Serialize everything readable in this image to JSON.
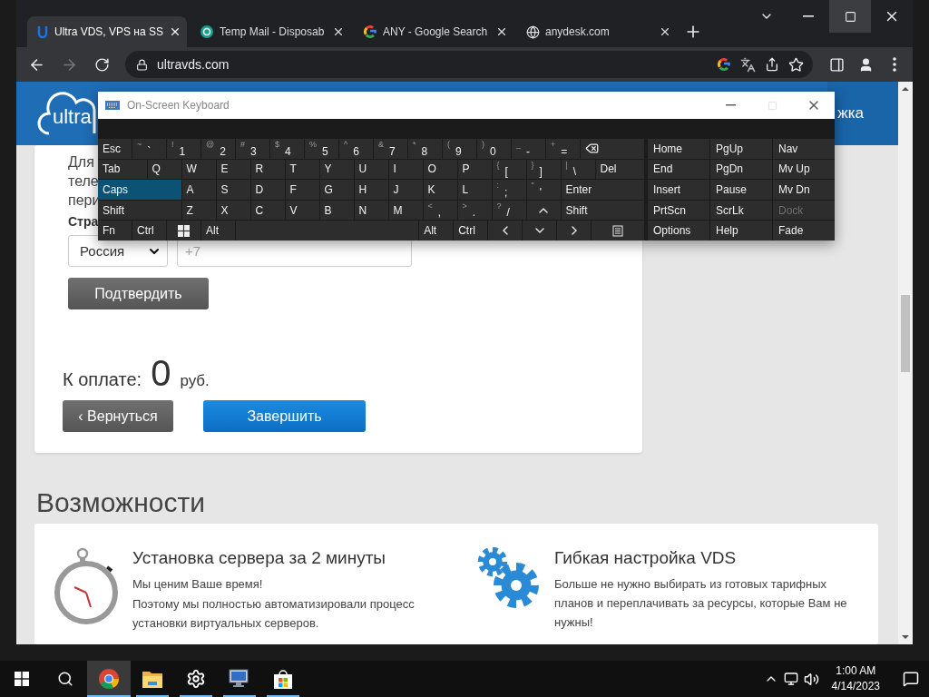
{
  "browser": {
    "tabs": [
      {
        "kind": "ultra",
        "title": "Ultra VDS, VPS на SS",
        "selected": true
      },
      {
        "kind": "mail",
        "title": "Temp Mail - Disposab",
        "selected": false
      },
      {
        "kind": "google",
        "title": "ANY - Google Search",
        "selected": false
      },
      {
        "kind": "globe",
        "title": "anydesk.com",
        "selected": false
      }
    ],
    "window_controls": [
      {
        "kind": "tabsearch",
        "hovered": false
      },
      {
        "kind": "minimize",
        "hovered": false
      },
      {
        "kind": "maximize",
        "hovered": true
      },
      {
        "kind": "close",
        "hovered": false
      }
    ],
    "nav": [
      {
        "kind": "back",
        "disabled": false
      },
      {
        "kind": "forward",
        "disabled": true
      },
      {
        "kind": "reload",
        "disabled": false
      }
    ],
    "address": "ultravds.com"
  },
  "page": {
    "header": {
      "logo": "ultra",
      "nav_item": "жка"
    },
    "order_card": {
      "lines": [
        "Для",
        "теле",
        "пери"
      ],
      "country_label": "Стра",
      "country": "Россия",
      "phone_placeholder": "+7",
      "confirm_button": "Подтвердить",
      "total_label": "К оплате:",
      "total": "0",
      "currency": "руб.",
      "back_button": "‹ Вернуться",
      "finish_button": "Завершить"
    },
    "features": {
      "heading": "Возможности",
      "items": [
        {
          "kind": "stopwatch",
          "title": "Установка сервера за 2 минуты",
          "paragraphs": [
            "Мы ценим Ваше время!",
            "Поэтому мы полностью автоматизировали процесс установки виртуальных серверов."
          ]
        },
        {
          "kind": "gears",
          "title": "Гибкая настройка VDS",
          "paragraphs": [
            "Больше не нужно выбирать из готовых тарифных планов и переплачивать за ресурсы, которые Вам не нужны!"
          ]
        }
      ]
    }
  },
  "keyboard": {
    "title": "On-Screen Keyboard",
    "maximize_disabled": true,
    "rows": [
      {
        "keys": [
          {
            "kind": "key",
            "label": "Esc",
            "on": false
          },
          {
            "kind": "char",
            "shift": "~",
            "label": "`",
            "on": false
          },
          {
            "kind": "char",
            "shift": "!",
            "label": "1",
            "on": false
          },
          {
            "kind": "char",
            "shift": "@",
            "label": "2",
            "on": false
          },
          {
            "kind": "char",
            "shift": "#",
            "label": "3",
            "on": false
          },
          {
            "kind": "char",
            "shift": "$",
            "label": "4",
            "on": false
          },
          {
            "kind": "char",
            "shift": "%",
            "label": "5",
            "on": false
          },
          {
            "kind": "char",
            "shift": "^",
            "label": "6",
            "on": false
          },
          {
            "kind": "char",
            "shift": "&",
            "label": "7",
            "on": false
          },
          {
            "kind": "char",
            "shift": "*",
            "label": "8",
            "on": false
          },
          {
            "kind": "char",
            "shift": "(",
            "label": "9",
            "on": false
          },
          {
            "kind": "char",
            "shift": ")",
            "label": "0",
            "on": false
          },
          {
            "kind": "char",
            "shift": "_",
            "label": "-",
            "on": false
          },
          {
            "kind": "char",
            "shift": "+",
            "label": "=",
            "on": false
          },
          {
            "kind": "backspace",
            "on": false
          }
        ]
      },
      {
        "keys": [
          {
            "kind": "wide",
            "label": "Tab",
            "on": false
          },
          {
            "kind": "key",
            "label": "Q",
            "on": false
          },
          {
            "kind": "key",
            "label": "W",
            "on": false
          },
          {
            "kind": "key",
            "label": "E",
            "on": false
          },
          {
            "kind": "key",
            "label": "R",
            "on": false
          },
          {
            "kind": "key",
            "label": "T",
            "on": false
          },
          {
            "kind": "key",
            "label": "Y",
            "on": false
          },
          {
            "kind": "key",
            "label": "U",
            "on": false
          },
          {
            "kind": "key",
            "label": "I",
            "on": false
          },
          {
            "kind": "key",
            "label": "O",
            "on": false
          },
          {
            "kind": "key",
            "label": "P",
            "on": false
          },
          {
            "kind": "char",
            "shift": "{",
            "label": "[",
            "on": false
          },
          {
            "kind": "char",
            "shift": "}",
            "label": "]",
            "on": false
          },
          {
            "kind": "char",
            "shift": "|",
            "label": "\\",
            "on": false
          },
          {
            "kind": "wide",
            "label": "Del",
            "on": false
          }
        ]
      },
      {
        "keys": [
          {
            "kind": "wide",
            "label": "Caps",
            "on": true
          },
          {
            "kind": "key",
            "label": "A",
            "on": false
          },
          {
            "kind": "key",
            "label": "S",
            "on": false
          },
          {
            "kind": "key",
            "label": "D",
            "on": false
          },
          {
            "kind": "key",
            "label": "F",
            "on": false
          },
          {
            "kind": "key",
            "label": "G",
            "on": false
          },
          {
            "kind": "key",
            "label": "H",
            "on": false
          },
          {
            "kind": "key",
            "label": "J",
            "on": false
          },
          {
            "kind": "key",
            "label": "K",
            "on": false
          },
          {
            "kind": "key",
            "label": "L",
            "on": false
          },
          {
            "kind": "char",
            "shift": ":",
            "label": ";",
            "on": false
          },
          {
            "kind": "char",
            "shift": "\"",
            "label": "'",
            "on": false
          },
          {
            "kind": "wide",
            "label": "Enter",
            "on": false
          }
        ]
      },
      {
        "keys": [
          {
            "kind": "wide",
            "label": "Shift",
            "on": false
          },
          {
            "kind": "key",
            "label": "Z",
            "on": false
          },
          {
            "kind": "key",
            "label": "X",
            "on": false
          },
          {
            "kind": "key",
            "label": "C",
            "on": false
          },
          {
            "kind": "key",
            "label": "V",
            "on": false
          },
          {
            "kind": "key",
            "label": "B",
            "on": false
          },
          {
            "kind": "key",
            "label": "N",
            "on": false
          },
          {
            "kind": "key",
            "label": "M",
            "on": false
          },
          {
            "kind": "char",
            "shift": "<",
            "label": ",",
            "on": false
          },
          {
            "kind": "char",
            "shift": ">",
            "label": ".",
            "on": false
          },
          {
            "kind": "char",
            "shift": "?",
            "label": "/",
            "on": false
          },
          {
            "kind": "up",
            "on": false
          },
          {
            "kind": "wide",
            "label": "Shift",
            "on": false
          }
        ]
      },
      {
        "keys": [
          {
            "kind": "key",
            "label": "Fn",
            "on": false
          },
          {
            "kind": "key",
            "label": "Ctrl",
            "on": false
          },
          {
            "kind": "windows",
            "on": false
          },
          {
            "kind": "key",
            "label": "Alt",
            "on": false
          },
          {
            "kind": "space",
            "on": false
          },
          {
            "kind": "key",
            "label": "Alt",
            "on": false
          },
          {
            "kind": "key",
            "label": "Ctrl",
            "on": false
          },
          {
            "kind": "left",
            "on": false
          },
          {
            "kind": "down",
            "on": false
          },
          {
            "kind": "right",
            "on": false
          },
          {
            "kind": "menu",
            "on": false
          }
        ]
      }
    ],
    "side_rows": [
      {
        "keys": [
          {
            "label": "Home",
            "disabled": false
          },
          {
            "label": "PgUp",
            "disabled": false
          },
          {
            "label": "Nav",
            "disabled": false
          }
        ]
      },
      {
        "keys": [
          {
            "label": "End",
            "disabled": false
          },
          {
            "label": "PgDn",
            "disabled": false
          },
          {
            "label": "Mv Up",
            "disabled": false
          }
        ]
      },
      {
        "keys": [
          {
            "label": "Insert",
            "disabled": false
          },
          {
            "label": "Pause",
            "disabled": false
          },
          {
            "label": "Mv Dn",
            "disabled": false
          }
        ]
      },
      {
        "keys": [
          {
            "label": "PrtScn",
            "disabled": false
          },
          {
            "label": "ScrLk",
            "disabled": false
          },
          {
            "label": "Dock",
            "disabled": true
          }
        ]
      },
      {
        "keys": [
          {
            "label": "Options",
            "disabled": false
          },
          {
            "label": "Help",
            "disabled": false
          },
          {
            "label": "Fade",
            "disabled": false
          }
        ]
      }
    ]
  },
  "taskbar": {
    "apps": [
      {
        "kind": "chrome",
        "running": true,
        "selected": true
      },
      {
        "kind": "folder",
        "running": true,
        "selected": false
      },
      {
        "kind": "settings",
        "running": true,
        "selected": false
      },
      {
        "kind": "remote",
        "running": true,
        "selected": false
      },
      {
        "kind": "store",
        "running": true,
        "selected": false
      }
    ],
    "time": "1:00 AM",
    "date": "4/14/2023"
  }
}
